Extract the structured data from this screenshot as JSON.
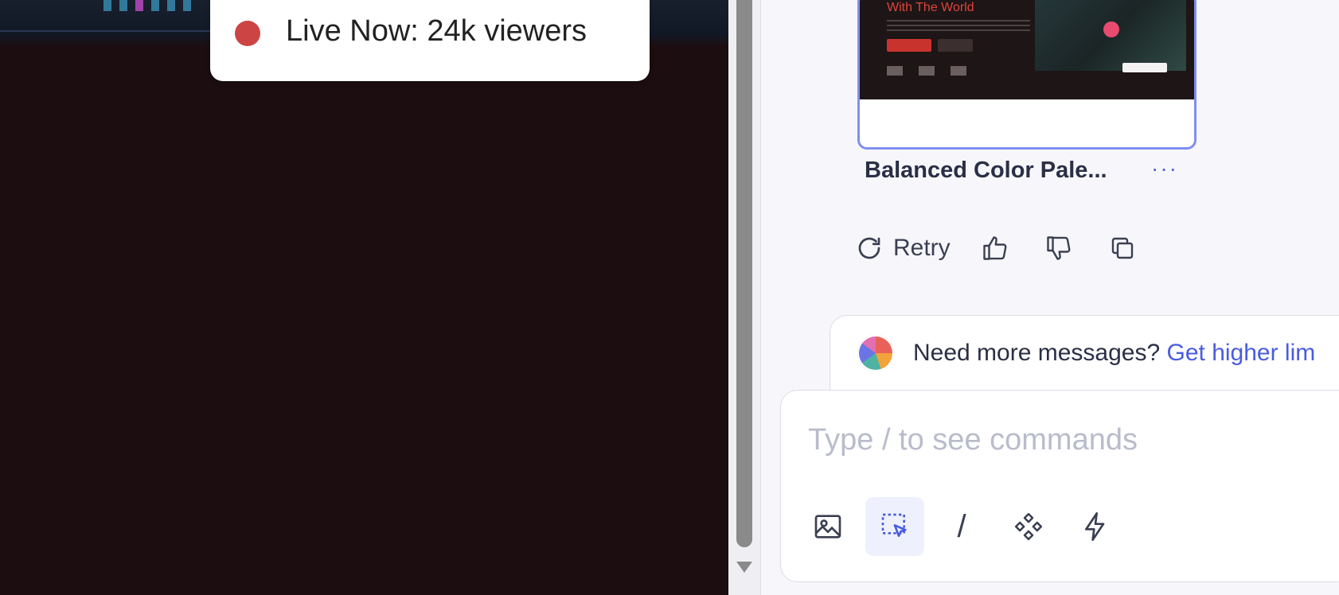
{
  "preview": {
    "live_badge": "Live Now: 24k viewers",
    "live_dot_color": "#cc4444",
    "background_color": "#1c0e10",
    "thumbnail_heading": "With The World"
  },
  "chat": {
    "card": {
      "title": "Balanced Color Pale...",
      "more_label": "···"
    },
    "actions": {
      "retry_label": "Retry",
      "icons": [
        "retry-icon",
        "thumbs-up-icon",
        "thumbs-down-icon",
        "copy-icon"
      ]
    },
    "limit_banner": {
      "text": "Need more messages?",
      "link": "Get higher lim"
    },
    "composer": {
      "placeholder": "Type / to see commands",
      "tools": [
        "image-icon",
        "select-element-icon",
        "slash-command",
        "components-icon",
        "lightning-icon"
      ],
      "slash_label": "/"
    },
    "accent_color": "#4a5ce0"
  }
}
